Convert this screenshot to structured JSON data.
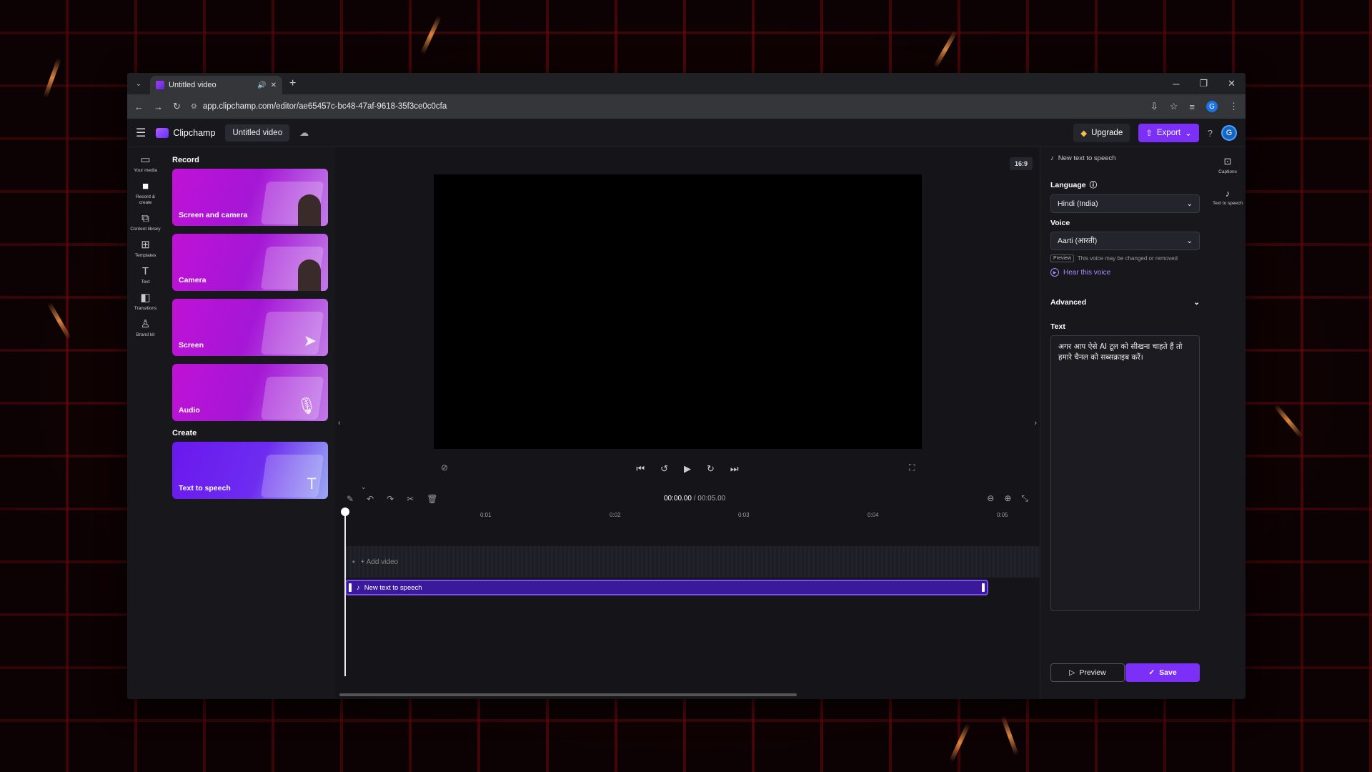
{
  "browser": {
    "tab_title": "Untitled video",
    "url": "app.clipchamp.com/editor/ae65457c-bc48-47af-9618-35f3ce0c0cfa"
  },
  "header": {
    "app_name": "Clipchamp",
    "project_title": "Untitled video",
    "upgrade_label": "Upgrade",
    "export_label": "Export",
    "avatar_initial": "G"
  },
  "rail": {
    "items": [
      {
        "label": "Your media",
        "icon": "folder-icon"
      },
      {
        "label": "Record & create",
        "icon": "camera-icon"
      },
      {
        "label": "Content library",
        "icon": "library-icon"
      },
      {
        "label": "Templates",
        "icon": "templates-icon"
      },
      {
        "label": "Text",
        "icon": "text-icon"
      },
      {
        "label": "Transitions",
        "icon": "transitions-icon"
      },
      {
        "label": "Brand kit",
        "icon": "brand-icon"
      }
    ]
  },
  "panel": {
    "record_title": "Record",
    "create_title": "Create",
    "record_cards": [
      "Screen and camera",
      "Camera",
      "Screen",
      "Audio"
    ],
    "create_cards": [
      "Text to speech"
    ]
  },
  "preview": {
    "aspect_ratio": "16:9"
  },
  "timeline": {
    "current_time": "00:00.00",
    "total_time": "/ 00:05.00",
    "ticks": [
      "0:01",
      "0:02",
      "0:03",
      "0:04",
      "0:05"
    ],
    "add_video": "+ Add video",
    "clip_label": "New text to speech"
  },
  "props": {
    "title": "New text to speech",
    "language_label": "Language",
    "language_value": "Hindi (India)",
    "voice_label": "Voice",
    "voice_value": "Aarti (आरती)",
    "preview_badge": "Preview",
    "voice_note": "This voice may be changed or removed",
    "hear_voice": "Hear this voice",
    "advanced_label": "Advanced",
    "text_label": "Text",
    "text_value": "अगर आप ऐसे AI टूल को सीखना चाहते हैं तो हमारे चैनल को सब्सक्राइब करें।",
    "preview_btn": "Preview",
    "save_btn": "Save"
  },
  "rrail": {
    "items": [
      {
        "label": "Captions"
      },
      {
        "label": "Text to speech"
      }
    ]
  },
  "colors": {
    "accent": "#7b2ff7",
    "brand_gradient": "#c012d6"
  }
}
